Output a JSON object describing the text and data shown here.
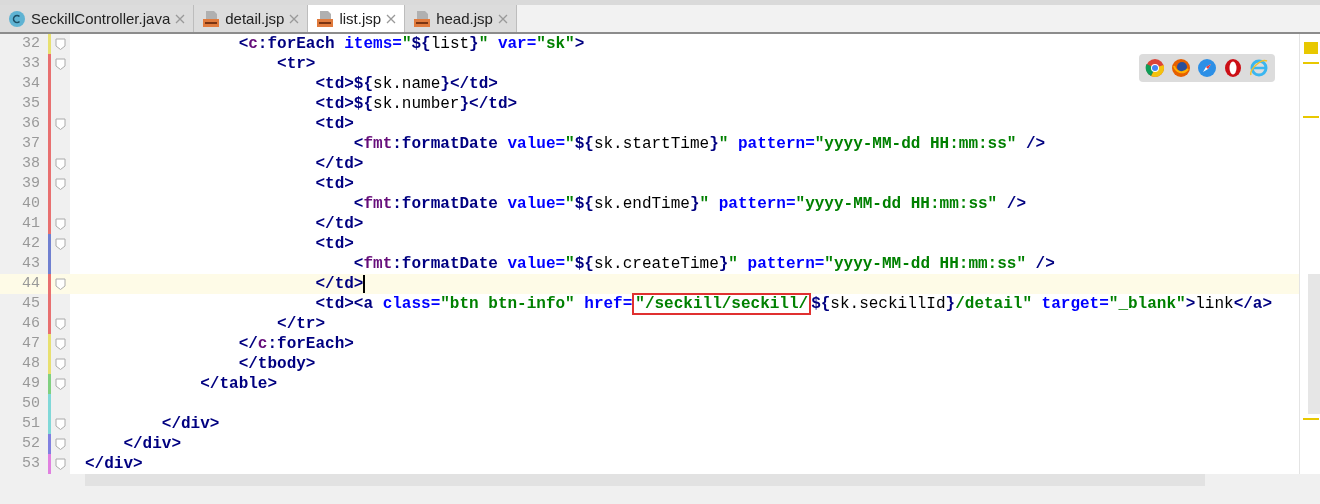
{
  "tabs": [
    {
      "label": "SeckillController.java",
      "kind": "java",
      "selected": false
    },
    {
      "label": "detail.jsp",
      "kind": "jsp",
      "selected": false
    },
    {
      "label": "list.jsp",
      "kind": "jsp",
      "selected": true
    },
    {
      "label": "head.jsp",
      "kind": "jsp",
      "selected": false
    }
  ],
  "lines": [
    {
      "number": "32",
      "color": "#e8e070",
      "fold": true,
      "current": false,
      "tokens": [
        {
          "kind": "tag",
          "text": "                <"
        },
        {
          "kind": "ns",
          "text": "c"
        },
        {
          "kind": "tag",
          "text": ":forEach "
        },
        {
          "kind": "attr",
          "text": "items="
        },
        {
          "kind": "value",
          "text": "\""
        },
        {
          "kind": "expr",
          "text": "${"
        },
        {
          "kind": "plain",
          "text": "list"
        },
        {
          "kind": "expr",
          "text": "}"
        },
        {
          "kind": "value",
          "text": "\" "
        },
        {
          "kind": "attr",
          "text": "var="
        },
        {
          "kind": "value",
          "text": "\"sk\""
        },
        {
          "kind": "tag",
          "text": ">"
        }
      ]
    },
    {
      "number": "33",
      "color": "#e87070",
      "fold": true,
      "current": false,
      "tokens": [
        {
          "kind": "tag",
          "text": "                    <tr>"
        }
      ]
    },
    {
      "number": "34",
      "color": "#e87070",
      "fold": false,
      "current": false,
      "tokens": [
        {
          "kind": "tag",
          "text": "                        <td>"
        },
        {
          "kind": "expr",
          "text": "${"
        },
        {
          "kind": "plain",
          "text": "sk.name"
        },
        {
          "kind": "expr",
          "text": "}"
        },
        {
          "kind": "tag",
          "text": "</td>"
        }
      ]
    },
    {
      "number": "35",
      "color": "#e87070",
      "fold": false,
      "current": false,
      "tokens": [
        {
          "kind": "tag",
          "text": "                        <td>"
        },
        {
          "kind": "expr",
          "text": "${"
        },
        {
          "kind": "plain",
          "text": "sk.number"
        },
        {
          "kind": "expr",
          "text": "}"
        },
        {
          "kind": "tag",
          "text": "</td>"
        }
      ]
    },
    {
      "number": "36",
      "color": "#e87070",
      "fold": true,
      "current": false,
      "tokens": [
        {
          "kind": "tag",
          "text": "                        <td>"
        }
      ]
    },
    {
      "number": "37",
      "color": "#e87070",
      "fold": false,
      "current": false,
      "tokens": [
        {
          "kind": "tag",
          "text": "                            <"
        },
        {
          "kind": "ns",
          "text": "fmt"
        },
        {
          "kind": "tag",
          "text": ":formatDate "
        },
        {
          "kind": "attr",
          "text": "value="
        },
        {
          "kind": "value",
          "text": "\""
        },
        {
          "kind": "expr",
          "text": "${"
        },
        {
          "kind": "plain",
          "text": "sk.startTime"
        },
        {
          "kind": "expr",
          "text": "}"
        },
        {
          "kind": "value",
          "text": "\" "
        },
        {
          "kind": "attr",
          "text": "pattern="
        },
        {
          "kind": "value",
          "text": "\"yyyy-MM-dd HH:mm:ss\" "
        },
        {
          "kind": "tag",
          "text": "/>"
        }
      ]
    },
    {
      "number": "38",
      "color": "#e87070",
      "fold": true,
      "current": false,
      "tokens": [
        {
          "kind": "tag",
          "text": "                        </td>"
        }
      ]
    },
    {
      "number": "39",
      "color": "#e87070",
      "fold": true,
      "current": false,
      "tokens": [
        {
          "kind": "tag",
          "text": "                        <td>"
        }
      ]
    },
    {
      "number": "40",
      "color": "#e87070",
      "fold": false,
      "current": false,
      "tokens": [
        {
          "kind": "tag",
          "text": "                            <"
        },
        {
          "kind": "ns",
          "text": "fmt"
        },
        {
          "kind": "tag",
          "text": ":formatDate "
        },
        {
          "kind": "attr",
          "text": "value="
        },
        {
          "kind": "value",
          "text": "\""
        },
        {
          "kind": "expr",
          "text": "${"
        },
        {
          "kind": "plain",
          "text": "sk.endTime"
        },
        {
          "kind": "expr",
          "text": "}"
        },
        {
          "kind": "value",
          "text": "\" "
        },
        {
          "kind": "attr",
          "text": "pattern="
        },
        {
          "kind": "value",
          "text": "\"yyyy-MM-dd HH:mm:ss\" "
        },
        {
          "kind": "tag",
          "text": "/>"
        }
      ]
    },
    {
      "number": "41",
      "color": "#e87070",
      "fold": true,
      "current": false,
      "tokens": [
        {
          "kind": "tag",
          "text": "                        </td>"
        }
      ]
    },
    {
      "number": "42",
      "color": "#7080d0",
      "fold": true,
      "current": false,
      "tokens": [
        {
          "kind": "tag",
          "text": "                        <td>"
        }
      ]
    },
    {
      "number": "43",
      "color": "#7080d0",
      "fold": false,
      "current": false,
      "tokens": [
        {
          "kind": "tag",
          "text": "                            <"
        },
        {
          "kind": "ns",
          "text": "fmt"
        },
        {
          "kind": "tag",
          "text": ":formatDate "
        },
        {
          "kind": "attr",
          "text": "value="
        },
        {
          "kind": "value",
          "text": "\""
        },
        {
          "kind": "expr",
          "text": "${"
        },
        {
          "kind": "plain",
          "text": "sk.createTime"
        },
        {
          "kind": "expr",
          "text": "}"
        },
        {
          "kind": "value",
          "text": "\" "
        },
        {
          "kind": "attr",
          "text": "pattern="
        },
        {
          "kind": "value",
          "text": "\"yyyy-MM-dd HH:mm:ss\" "
        },
        {
          "kind": "tag",
          "text": "/>"
        }
      ]
    },
    {
      "number": "44",
      "color": "#e87070",
      "fold": true,
      "current": true,
      "tokens": [
        {
          "kind": "tag",
          "text": "                        </td>"
        }
      ]
    },
    {
      "number": "45",
      "color": "#e87070",
      "fold": false,
      "current": false,
      "tokens": [
        {
          "kind": "tag",
          "text": "                        <td><a "
        },
        {
          "kind": "attr",
          "text": "class="
        },
        {
          "kind": "value",
          "text": "\"btn btn-info\" "
        },
        {
          "kind": "attr",
          "text": "href="
        },
        {
          "kind": "marked",
          "text": "\"/seckill/seckill/"
        },
        {
          "kind": "expr",
          "text": "${"
        },
        {
          "kind": "plain",
          "text": "sk.seckillId"
        },
        {
          "kind": "expr",
          "text": "}"
        },
        {
          "kind": "value",
          "text": "/detail\" "
        },
        {
          "kind": "attr",
          "text": "target="
        },
        {
          "kind": "value",
          "text": "\"_blank\""
        },
        {
          "kind": "tag",
          "text": ">"
        },
        {
          "kind": "plain",
          "text": "link"
        },
        {
          "kind": "tag",
          "text": "</a>"
        }
      ]
    },
    {
      "number": "46",
      "color": "#e87070",
      "fold": true,
      "current": false,
      "tokens": [
        {
          "kind": "tag",
          "text": "                    </tr>"
        }
      ]
    },
    {
      "number": "47",
      "color": "#e8e070",
      "fold": true,
      "current": false,
      "tokens": [
        {
          "kind": "tag",
          "text": "                </"
        },
        {
          "kind": "ns",
          "text": "c"
        },
        {
          "kind": "tag",
          "text": ":forEach>"
        }
      ]
    },
    {
      "number": "48",
      "color": "#e8e070",
      "fold": true,
      "current": false,
      "tokens": [
        {
          "kind": "tag",
          "text": "                </tbody>"
        }
      ]
    },
    {
      "number": "49",
      "color": "#80d080",
      "fold": true,
      "current": false,
      "tokens": [
        {
          "kind": "tag",
          "text": "            </table>"
        }
      ]
    },
    {
      "number": "50",
      "color": "#80d8d8",
      "fold": false,
      "current": false
    },
    {
      "number": "51",
      "color": "#80d8d8",
      "fold": true,
      "current": false,
      "tokens": [
        {
          "kind": "tag",
          "text": "        </div>"
        }
      ]
    },
    {
      "number": "52",
      "color": "#8080e0",
      "fold": true,
      "current": false,
      "tokens": [
        {
          "kind": "tag",
          "text": "    </div>"
        }
      ]
    },
    {
      "number": "53",
      "color": "#e080e0",
      "fold": true,
      "current": false,
      "tokens": [
        {
          "kind": "tag",
          "text": "</div>"
        }
      ]
    }
  ]
}
